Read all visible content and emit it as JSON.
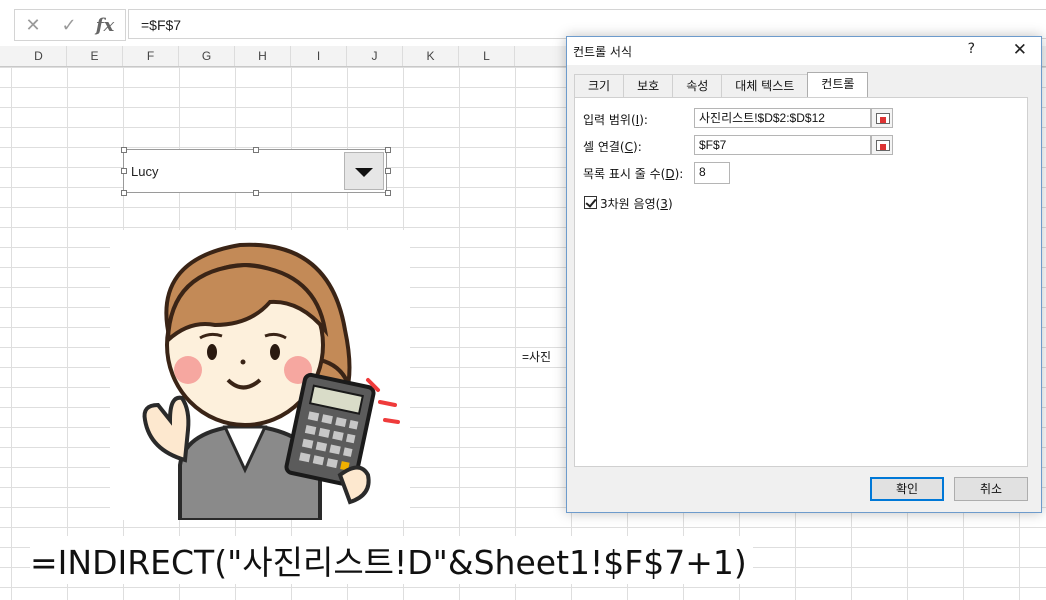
{
  "formula_bar": {
    "cancel_icon": "✕",
    "enter_icon": "✓",
    "fx_label": "fx",
    "formula": "=$F$7"
  },
  "columns": [
    "D",
    "E",
    "F",
    "G",
    "H",
    "I",
    "J",
    "K",
    "L"
  ],
  "combo_box": {
    "selected": "Lucy"
  },
  "picture": {
    "description_icon": "woman-with-calculator-illustration"
  },
  "cell_note": "=사진",
  "big_formula": "=INDIRECT(\"사진리스트!D\"&Sheet1!$F$7+1)",
  "dialog": {
    "title": "컨트롤 서식",
    "help": "?",
    "close": "✕",
    "tabs": [
      "크기",
      "보호",
      "속성",
      "대체 텍스트",
      "컨트롤"
    ],
    "active_tab": "컨트롤",
    "input_range_label": "입력 범위(I):",
    "input_range_prefix": "입력 범위(",
    "input_range_key": "I",
    "input_range_suffix": "):",
    "input_range_value": "사진리스트!$D$2:$D$12",
    "cell_link_prefix": "셀 연결(",
    "cell_link_key": "C",
    "cell_link_suffix": "):",
    "cell_link_value": "$F$7",
    "dropdown_lines_prefix": "목록 표시 줄 수(",
    "dropdown_lines_key": "D",
    "dropdown_lines_suffix": "):",
    "dropdown_lines_value": "8",
    "shading_prefix": "3차원 음영(",
    "shading_key": "3",
    "shading_suffix": ")",
    "shading_checked": true,
    "ok": "확인",
    "cancel": "취소"
  }
}
